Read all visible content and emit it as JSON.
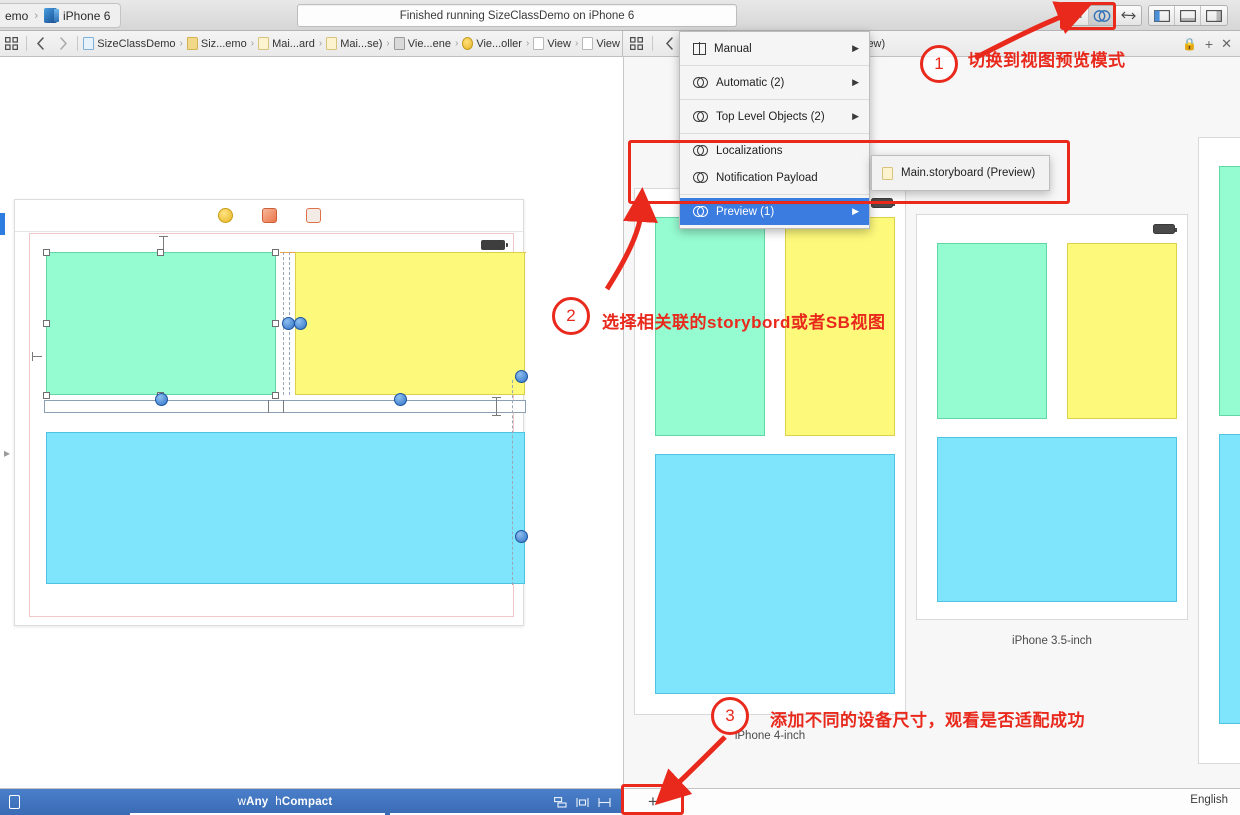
{
  "toolbar": {
    "scheme_project": "emo",
    "scheme_device": "iPhone 6",
    "status_text": "Finished running SizeClassDemo on iPhone 6",
    "editor_standard_icon": "standard-editor-icon",
    "editor_assistant_icon": "assistant-editor-icon",
    "editor_version_icon": "version-editor-icon",
    "panel_navigator_icon": "navigator-toggle-icon",
    "panel_debug_icon": "debug-area-toggle-icon",
    "panel_utilities_icon": "utilities-toggle-icon"
  },
  "jumpbar_left": {
    "related_icon": "related-items-icon",
    "back_icon": "back-chevron-icon",
    "forward_icon": "forward-chevron-icon",
    "crumbs": [
      {
        "label": "SizeClassDemo",
        "icon": "project-file-icon"
      },
      {
        "label": "Siz...emo",
        "icon": "folder-icon"
      },
      {
        "label": "Mai...ard",
        "icon": "storyboard-file-icon"
      },
      {
        "label": "Mai...se)",
        "icon": "storyboard-file-icon"
      },
      {
        "label": "Vie...ene",
        "icon": "scene-icon"
      },
      {
        "label": "Vie...oller",
        "icon": "view-controller-icon"
      },
      {
        "label": "View",
        "icon": "view-icon"
      },
      {
        "label": "View",
        "icon": "view-icon"
      }
    ]
  },
  "jumpbar_right": {
    "related_icon": "related-items-icon",
    "back_icon": "back-chevron-icon",
    "crumb_text": "iew)",
    "lock_icon": "lock-icon",
    "add_icon": "add-assistant-icon",
    "close_icon": "close-assistant-icon"
  },
  "menu": {
    "items": [
      {
        "label": "Manual",
        "icon": "manual-split-icon",
        "has_submenu": true,
        "selected": false
      },
      {
        "label": "Automatic (2)",
        "icon": "automatic-venn-icon",
        "has_submenu": true,
        "selected": false
      },
      {
        "label": "Top Level Objects (2)",
        "icon": "automatic-venn-icon",
        "has_submenu": true,
        "selected": false
      },
      {
        "label": "Localizations",
        "icon": "automatic-venn-icon",
        "has_submenu": false,
        "selected": false
      },
      {
        "label": "Notification Payload",
        "icon": "automatic-venn-icon",
        "has_submenu": false,
        "selected": false
      },
      {
        "label": "Preview (1)",
        "icon": "automatic-venn-icon",
        "has_submenu": true,
        "selected": true
      }
    ],
    "submenu": [
      {
        "label": "Main.storyboard (Preview)",
        "icon": "storyboard-file-icon"
      }
    ]
  },
  "canvas": {
    "dock_icons": [
      "view-controller-dock-icon",
      "first-responder-dock-icon",
      "exit-dock-icon"
    ],
    "views": [
      {
        "name": "green-view",
        "color": "#95fbd0"
      },
      {
        "name": "yellow-view",
        "color": "#fdf97b"
      },
      {
        "name": "blue-view",
        "color": "#7fe5fd"
      }
    ]
  },
  "preview": {
    "devices": [
      {
        "label": "iPhone 4-inch",
        "boxes": [
          "#95fbd0",
          "#fdf97b",
          "#7fe5fd"
        ]
      },
      {
        "label": "iPhone 3.5-inch",
        "boxes": [
          "#95fbd0",
          "#fdf97b",
          "#7fe5fd"
        ]
      },
      {
        "label": "",
        "boxes": [
          "#95fbd0",
          "#fdf97b",
          "#7fe5fd"
        ]
      }
    ]
  },
  "sizeclass_bar": {
    "device_icon": "device-orientation-icon",
    "width_prefix": "w",
    "width_value": "Any",
    "height_prefix": "h",
    "height_value": "Compact",
    "tool_icons": [
      "constraints-icon",
      "align-icon",
      "pin-icon"
    ],
    "add_label": "+",
    "language_label": "English"
  },
  "annotations": [
    {
      "number": "1",
      "text": "切换到视图预览模式"
    },
    {
      "number": "2",
      "text": "选择相关联的storybord或者SB视图"
    },
    {
      "number": "3",
      "text": "添加不同的设备尺寸，观看是否适配成功"
    }
  ],
  "accent_colors": {
    "annotation_red": "#e8291c",
    "menu_highlight_blue": "#3b7ce0",
    "sizeclass_bar_blue": "#3a6bb5"
  }
}
